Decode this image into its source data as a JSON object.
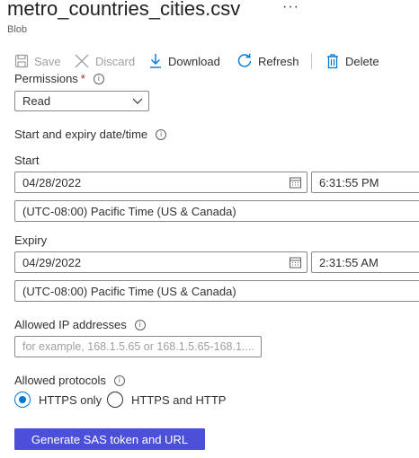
{
  "header": {
    "title": "metro_countries_cities.csv",
    "more": "···",
    "subtitle": "Blob"
  },
  "toolbar": {
    "save": "Save",
    "discard": "Discard",
    "download": "Download",
    "refresh": "Refresh",
    "delete": "Delete"
  },
  "form": {
    "permissions_label": "Permissions",
    "permissions_required": "*",
    "permissions_value": "Read",
    "date_section_label": "Start and expiry date/time",
    "start_label": "Start",
    "start_date": "04/28/2022",
    "start_time": "6:31:55 PM",
    "start_timezone": "(UTC-08:00) Pacific Time (US & Canada)",
    "expiry_label": "Expiry",
    "expiry_date": "04/29/2022",
    "expiry_time": "2:31:55 AM",
    "expiry_timezone": "(UTC-08:00) Pacific Time (US & Canada)",
    "ip_label": "Allowed IP addresses",
    "ip_placeholder": "for example, 168.1.5.65 or 168.1.5.65-168.1....",
    "protocols_label": "Allowed protocols",
    "protocol_https_only": "HTTPS only",
    "protocol_https_http": "HTTPS and HTTP",
    "protocol_selected": "HTTPS only",
    "generate_button": "Generate SAS token and URL"
  },
  "icons": {
    "info": "i",
    "colors": {
      "accent": "#0078d4",
      "primary_button": "#4c50d8",
      "disabled_text": "#a19f9d"
    }
  }
}
